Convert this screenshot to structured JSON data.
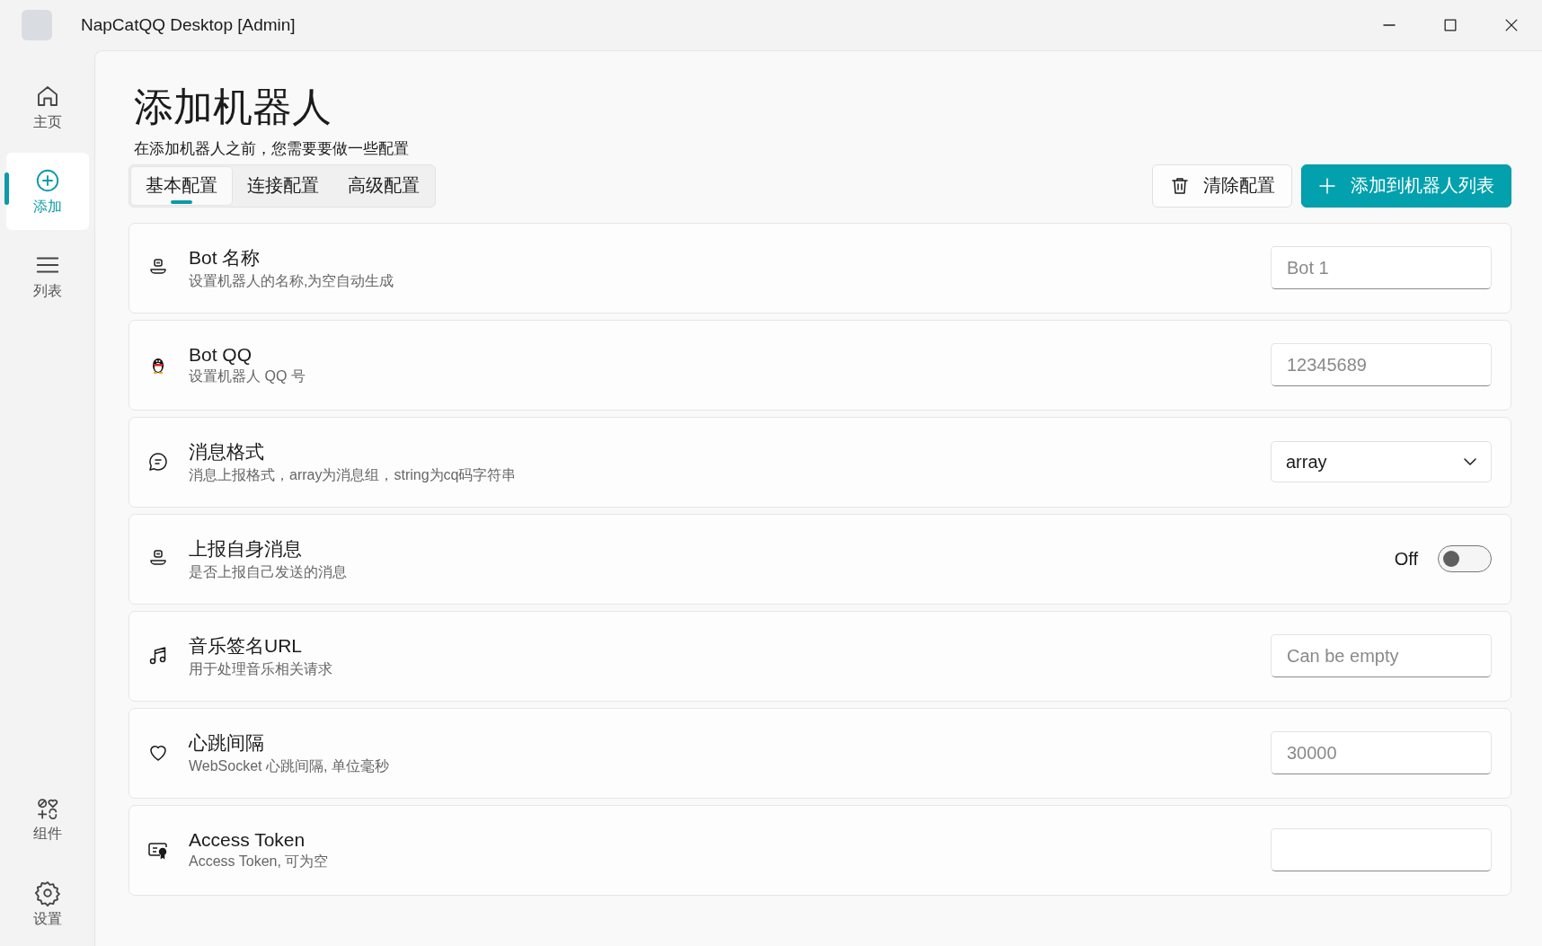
{
  "window": {
    "title": "NapCatQQ Desktop [Admin]"
  },
  "sidebar": {
    "items": [
      {
        "label": "主页",
        "selected": false
      },
      {
        "label": "添加",
        "selected": true
      },
      {
        "label": "列表",
        "selected": false
      }
    ],
    "bottom_items": [
      {
        "label": "组件",
        "selected": false
      },
      {
        "label": "设置",
        "selected": false
      }
    ]
  },
  "page": {
    "title": "添加机器人",
    "subtitle": "在添加机器人之前，您需要要做一些配置"
  },
  "tabs": [
    {
      "label": "基本配置",
      "selected": true
    },
    {
      "label": "连接配置",
      "selected": false
    },
    {
      "label": "高级配置",
      "selected": false
    }
  ],
  "buttons": {
    "clear": "清除配置",
    "add": "添加到机器人列表"
  },
  "rows": [
    {
      "title": "Bot 名称",
      "description": "设置机器人的名称,为空自动生成",
      "control": {
        "kind": "text",
        "placeholder": "Bot 1"
      }
    },
    {
      "title": "Bot QQ",
      "description": "设置机器人 QQ 号",
      "control": {
        "kind": "text",
        "placeholder": "12345689"
      }
    },
    {
      "title": "消息格式",
      "description": "消息上报格式，array为消息组，string为cq码字符串",
      "control": {
        "kind": "select",
        "value": "array"
      }
    },
    {
      "title": "上报自身消息",
      "description": "是否上报自己发送的消息",
      "control": {
        "kind": "toggle",
        "on": false,
        "label": "Off"
      }
    },
    {
      "title": "音乐签名URL",
      "description": "用于处理音乐相关请求",
      "control": {
        "kind": "text",
        "placeholder": "Can be empty"
      }
    },
    {
      "title": "心跳间隔",
      "description": "WebSocket 心跳间隔, 单位毫秒",
      "control": {
        "kind": "text",
        "placeholder": "30000"
      }
    },
    {
      "title": "Access Token",
      "description": "Access Token, 可为空",
      "control": {
        "kind": "text"
      }
    }
  ]
}
